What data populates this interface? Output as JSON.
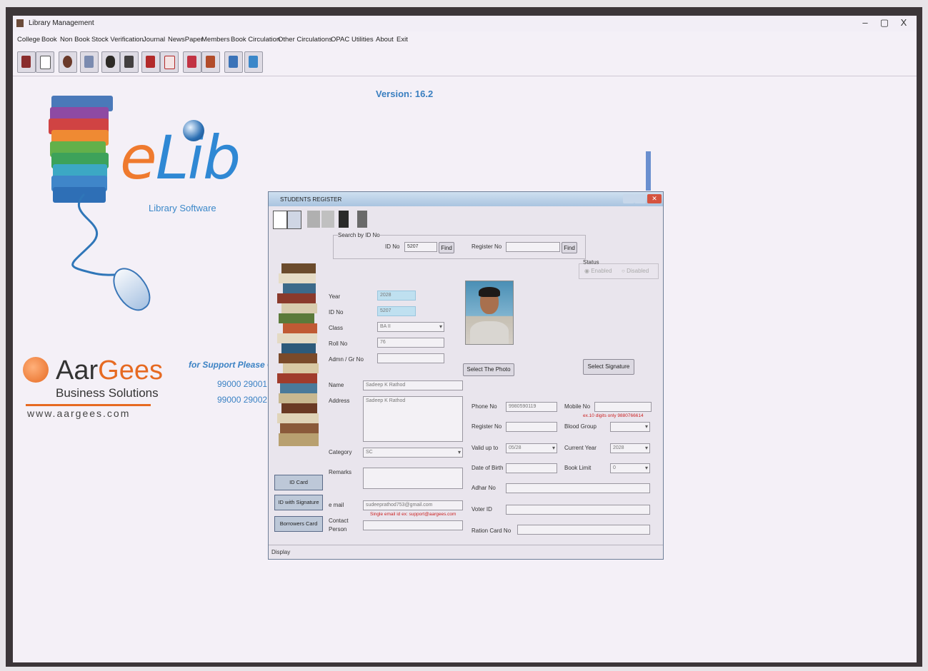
{
  "window": {
    "title": "Library Management",
    "min": "–",
    "max": "▢",
    "close": "X"
  },
  "menu": [
    "College",
    "Book",
    "Non Book",
    "Stock Verification",
    "Journal",
    "NewsPaper",
    "Members",
    "Book Circulation",
    "Other Circulations",
    "OPAC",
    "Utilities",
    "About",
    "Exit"
  ],
  "version": "Version: 16.2",
  "logo": {
    "e": "e",
    "lib": "Lib",
    "subtitle": "Library Software"
  },
  "company": {
    "name_a": "Aar",
    "name_b": "Gees",
    "tagline": "Business Solutions",
    "website": "www.aargees.com"
  },
  "support": {
    "text": "for Support Please Co",
    "phone1": "99000 29001",
    "phone2": "99000 29002"
  },
  "dialog": {
    "title": "STUDENTS REGISTER",
    "search_group": "Search by ID No",
    "id_no_label": "ID No",
    "id_no_value": "5207",
    "find1": "Find",
    "register_no_label": "Register No",
    "register_no_value": "",
    "find2": "Find",
    "status_label": "Status",
    "status_enabled": "Enabled",
    "status_disabled": "Disabled",
    "year_label": "Year",
    "year_value": "2028",
    "idno_label": "ID No",
    "idno_value": "5207",
    "class_label": "Class",
    "class_value": "BA II",
    "roll_label": "Roll No",
    "roll_value": "76",
    "admn_label": "Admn / Gr No",
    "admn_value": "",
    "select_photo": "Select The Photo",
    "select_signature": "Select Signature",
    "name_label": "Name",
    "name_value": "Sadeep K Rathod",
    "address_label": "Address",
    "address_value": "Sadeep K Rathod",
    "phone_label": "Phone No",
    "phone_value": "9980590119",
    "mobile_label": "Mobile No",
    "mobile_value": "",
    "mobile_hint": "ex.10 digits only 9880766614",
    "regno_label": "Register No",
    "regno_value": "",
    "blood_label": "Blood Group",
    "blood_value": "",
    "category_label": "Category",
    "category_value": "SC",
    "validupto_label": "Valid up to",
    "validupto_value": "05/28",
    "curyear_label": "Current Year",
    "curyear_value": "2028",
    "remarks_label": "Remarks",
    "remarks_value": "",
    "dob_label": "Date of Birth",
    "dob_value": "",
    "booklimit_label": "Book Limit",
    "booklimit_value": "0",
    "adhar_label": "Adhar No",
    "adhar_value": "",
    "email_label": "e mail",
    "email_value": "sudeeprathod753@gmail.com",
    "email_hint": "Single email id ex: support@aargees.com",
    "voter_label": "Voter ID",
    "voter_value": "",
    "contact_label1": "Contact",
    "contact_label2": "Person",
    "contact_value": "",
    "ration_label": "Ration Card No",
    "ration_value": "",
    "idcard_btn": "ID Card",
    "idsig_btn": "ID with Signature",
    "borrowers_btn": "Borrowers Card",
    "status_bar": "Display"
  },
  "colors": {
    "accent": "#3a7fc0",
    "orange": "#e66a22",
    "error": "#c22222"
  }
}
